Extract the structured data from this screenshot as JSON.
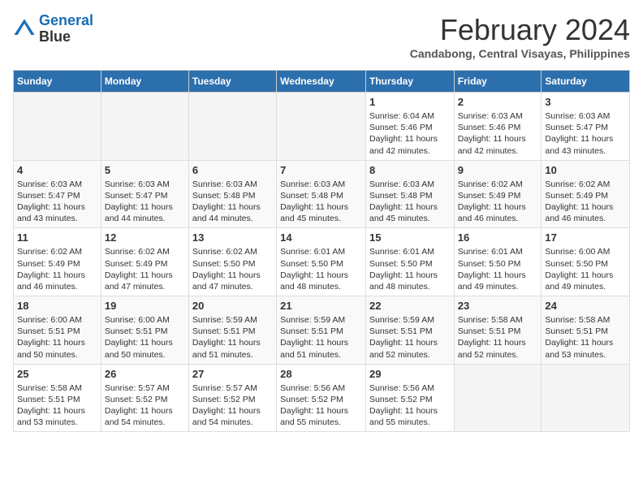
{
  "logo": {
    "line1": "General",
    "line2": "Blue"
  },
  "title": "February 2024",
  "subtitle": "Candabong, Central Visayas, Philippines",
  "days_header": [
    "Sunday",
    "Monday",
    "Tuesday",
    "Wednesday",
    "Thursday",
    "Friday",
    "Saturday"
  ],
  "weeks": [
    [
      {
        "day": "",
        "sunrise": "",
        "sunset": "",
        "daylight": "",
        "empty": true
      },
      {
        "day": "",
        "sunrise": "",
        "sunset": "",
        "daylight": "",
        "empty": true
      },
      {
        "day": "",
        "sunrise": "",
        "sunset": "",
        "daylight": "",
        "empty": true
      },
      {
        "day": "",
        "sunrise": "",
        "sunset": "",
        "daylight": "",
        "empty": true
      },
      {
        "day": "1",
        "sunrise": "6:04 AM",
        "sunset": "5:46 PM",
        "daylight": "11 hours and 42 minutes."
      },
      {
        "day": "2",
        "sunrise": "6:03 AM",
        "sunset": "5:46 PM",
        "daylight": "11 hours and 42 minutes."
      },
      {
        "day": "3",
        "sunrise": "6:03 AM",
        "sunset": "5:47 PM",
        "daylight": "11 hours and 43 minutes."
      }
    ],
    [
      {
        "day": "4",
        "sunrise": "6:03 AM",
        "sunset": "5:47 PM",
        "daylight": "11 hours and 43 minutes."
      },
      {
        "day": "5",
        "sunrise": "6:03 AM",
        "sunset": "5:47 PM",
        "daylight": "11 hours and 44 minutes."
      },
      {
        "day": "6",
        "sunrise": "6:03 AM",
        "sunset": "5:48 PM",
        "daylight": "11 hours and 44 minutes."
      },
      {
        "day": "7",
        "sunrise": "6:03 AM",
        "sunset": "5:48 PM",
        "daylight": "11 hours and 45 minutes."
      },
      {
        "day": "8",
        "sunrise": "6:03 AM",
        "sunset": "5:48 PM",
        "daylight": "11 hours and 45 minutes."
      },
      {
        "day": "9",
        "sunrise": "6:02 AM",
        "sunset": "5:49 PM",
        "daylight": "11 hours and 46 minutes."
      },
      {
        "day": "10",
        "sunrise": "6:02 AM",
        "sunset": "5:49 PM",
        "daylight": "11 hours and 46 minutes."
      }
    ],
    [
      {
        "day": "11",
        "sunrise": "6:02 AM",
        "sunset": "5:49 PM",
        "daylight": "11 hours and 46 minutes."
      },
      {
        "day": "12",
        "sunrise": "6:02 AM",
        "sunset": "5:49 PM",
        "daylight": "11 hours and 47 minutes."
      },
      {
        "day": "13",
        "sunrise": "6:02 AM",
        "sunset": "5:50 PM",
        "daylight": "11 hours and 47 minutes."
      },
      {
        "day": "14",
        "sunrise": "6:01 AM",
        "sunset": "5:50 PM",
        "daylight": "11 hours and 48 minutes."
      },
      {
        "day": "15",
        "sunrise": "6:01 AM",
        "sunset": "5:50 PM",
        "daylight": "11 hours and 48 minutes."
      },
      {
        "day": "16",
        "sunrise": "6:01 AM",
        "sunset": "5:50 PM",
        "daylight": "11 hours and 49 minutes."
      },
      {
        "day": "17",
        "sunrise": "6:00 AM",
        "sunset": "5:50 PM",
        "daylight": "11 hours and 49 minutes."
      }
    ],
    [
      {
        "day": "18",
        "sunrise": "6:00 AM",
        "sunset": "5:51 PM",
        "daylight": "11 hours and 50 minutes."
      },
      {
        "day": "19",
        "sunrise": "6:00 AM",
        "sunset": "5:51 PM",
        "daylight": "11 hours and 50 minutes."
      },
      {
        "day": "20",
        "sunrise": "5:59 AM",
        "sunset": "5:51 PM",
        "daylight": "11 hours and 51 minutes."
      },
      {
        "day": "21",
        "sunrise": "5:59 AM",
        "sunset": "5:51 PM",
        "daylight": "11 hours and 51 minutes."
      },
      {
        "day": "22",
        "sunrise": "5:59 AM",
        "sunset": "5:51 PM",
        "daylight": "11 hours and 52 minutes."
      },
      {
        "day": "23",
        "sunrise": "5:58 AM",
        "sunset": "5:51 PM",
        "daylight": "11 hours and 52 minutes."
      },
      {
        "day": "24",
        "sunrise": "5:58 AM",
        "sunset": "5:51 PM",
        "daylight": "11 hours and 53 minutes."
      }
    ],
    [
      {
        "day": "25",
        "sunrise": "5:58 AM",
        "sunset": "5:51 PM",
        "daylight": "11 hours and 53 minutes."
      },
      {
        "day": "26",
        "sunrise": "5:57 AM",
        "sunset": "5:52 PM",
        "daylight": "11 hours and 54 minutes."
      },
      {
        "day": "27",
        "sunrise": "5:57 AM",
        "sunset": "5:52 PM",
        "daylight": "11 hours and 54 minutes."
      },
      {
        "day": "28",
        "sunrise": "5:56 AM",
        "sunset": "5:52 PM",
        "daylight": "11 hours and 55 minutes."
      },
      {
        "day": "29",
        "sunrise": "5:56 AM",
        "sunset": "5:52 PM",
        "daylight": "11 hours and 55 minutes."
      },
      {
        "day": "",
        "sunrise": "",
        "sunset": "",
        "daylight": "",
        "empty": true
      },
      {
        "day": "",
        "sunrise": "",
        "sunset": "",
        "daylight": "",
        "empty": true
      }
    ]
  ]
}
